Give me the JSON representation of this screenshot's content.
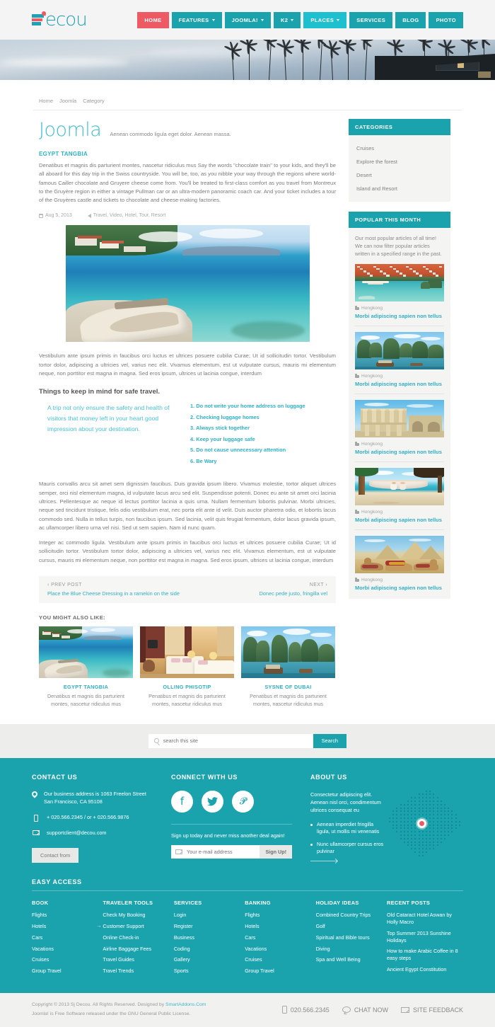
{
  "header": {
    "logo_text": "ecou",
    "nav": [
      {
        "label": "HOME",
        "caret": false,
        "state": "home"
      },
      {
        "label": "FEATURES",
        "caret": true,
        "state": "normal"
      },
      {
        "label": "JOOMLA!",
        "caret": true,
        "state": "normal"
      },
      {
        "label": "K2",
        "caret": true,
        "state": "normal"
      },
      {
        "label": "PLACES",
        "caret": true,
        "state": "active"
      },
      {
        "label": "SERVICES",
        "caret": false,
        "state": "normal"
      },
      {
        "label": "BLOG",
        "caret": false,
        "state": "normal"
      },
      {
        "label": "PHOTO",
        "caret": false,
        "state": "normal"
      }
    ]
  },
  "breadcrumb": [
    "Home",
    "Joomla",
    "Category"
  ],
  "article": {
    "title": "Joomla",
    "subtitle": "Aenean commodo ligula eget dolor. Aenean massa.",
    "post_sub": "EGYPT TANGBIA",
    "intro": "Denatibus et magnis dis parturient montes, nascetur ridiculus mus Say the words \"chocolate train\" to your kids, and they'll be all aboard for this day trip in the Swiss countryside. You will be, too, as you nibble your way through the regions where world-famous Cailler chocolate and Gruyere cheese come from. You'll be treated to first-class comfort as you travel from Montreux to the Gruyère region in either a vintage Pullman car or an ultra-modern panoramic coach car. And your ticket includes a tour of the Gruyères castle and tickets to chocolate and cheese-making factories.",
    "date": "Aug 5, 2013",
    "tags": "Travel, Video, Hotel, Tour, Resort",
    "para2": "Vestibulum ante ipsum primis in faucibus orci luctus et ultrices posuere cubilia Curae; Ut id sollicitudin tortor. Vestibulum tortor dolor, adipiscing a ultricies vel, varius nec elit. Vivamus elementum, est ut vulputate cursus, mauris mi elementum neque, non porttitor est magna in magna. Sed eros ipsum, ultrices ut lacinia congue, interdum",
    "section_heading": "Things to keep in mind for safe travel.",
    "quote": "A trip not only ensure the safety and health of visitors that money left in your heart good impression about your destination.",
    "tips": [
      "Do not write your home address on luggage",
      "Checking luggage homes",
      "Always stick together",
      "Keep your luggage safe",
      "Do not cause unnecessary attention",
      "Be Wary"
    ],
    "para3": "Mauris convallis arcu sit amet sem dignissim faucibus. Duis gravida ipsum libero. Vivamus molestie, tortor aliquet ultrices semper, orci nisl elementum magna, id vulputate lacus arcu sed elit. Suspendisse potenti. Donec eu ante sit amet orci lacinia ultrices. Pellentesque ac neque id lectus porttitor lacinia a quis urna. Nullam fermentum lobortis pulvinar. Morbi ultricies, neque sed tincidunt tristique, felis odio vestibulum erat, nec porta elit ante id velit. Duis auctor pharetra odio, et lobortis lacus commodo sed. Nulla in tellus turpis, non faucibus ipsum. Sed lacinia, velit quis feugiat fermentum, dolor lacus gravida ipsum, ac ullamcorper libero urna vel nisi. Sed ut sem sapien. Nam id nunc quam.",
    "para4": "Integer ac commodo ligula. Vestibulum ante ipsum primis in faucibus orci luctus et ultrices posuere cubilia Curae; Ut id sollicitudin tortor. Vestibulum tortor dolor, adipiscing a ultricies vel, varius nec elit. Vivamus elementum, est ut vulputate cursus, mauris mi elementum neque, non porttitor est magna in magna. Sed eros ipsum, ultrices ut lacinia congue, interdum"
  },
  "postnav": {
    "prev_label": "‹ PREV POST",
    "prev_link": "Place the Blue Cheese Dressing in a ramekin on the side",
    "next_label": "NEXT ›",
    "next_link": "Donec pede justo, fringilla vel"
  },
  "also_like": {
    "heading": "YOU MIGHT ALSO LIKE:",
    "cards": [
      {
        "title": "EGYPT TANGBIA",
        "desc": "Denatibus et magnis dis parturient montes, nascetur ridiculus mus",
        "image": "beach-stone-boat"
      },
      {
        "title": "OLLING PHISOTIP",
        "desc": "Penatibus et magnis dis parturient montes, nascetur ridiculus mus",
        "image": "hotel-room"
      },
      {
        "title": "SYSNE OF DUBAI",
        "desc": "Penatibus et magnis dis parturient montes, nascetur ridiculus mus",
        "image": "halong-bay"
      }
    ]
  },
  "sidebar": {
    "categories_title": "CATEGORIES",
    "categories": [
      "Cruises",
      "Explore the forest",
      "Desert",
      "Island and Resort"
    ],
    "popular_title": "POPULAR THIS MONTH",
    "popular_intro": "Our most popular articles of all time! We can now filter popular articles written in a specified range in the past.",
    "popular_items": [
      {
        "category": "Hongkong",
        "title": "Morbi adipiscing sapien non tellus",
        "image": "dubrovnik-coast"
      },
      {
        "category": "Hongkong",
        "title": "Morbi adipiscing sapien non tellus",
        "image": "halong-bay"
      },
      {
        "category": "Hongkong",
        "title": "Morbi adipiscing sapien non tellus",
        "image": "ephesus-ruins"
      },
      {
        "category": "Hongkong",
        "title": "Morbi adipiscing sapien non tellus",
        "image": "beach-hammock"
      },
      {
        "category": "Hongkong",
        "title": "Morbi adipiscing sapien non tellus",
        "image": "camels-pyramids"
      }
    ]
  },
  "search": {
    "placeholder": "search this site",
    "button": "Search"
  },
  "footer": {
    "contact": {
      "title": "CONTACT US",
      "address": "Our business address is 1063 Freelon Street San Francisco, CA 95108",
      "phone": "+ 020.566.2345 /  or  + 020.566.9876",
      "email": "supportclient@decou.com",
      "button": "Contact from"
    },
    "connect": {
      "title": "CONNECT WITH US",
      "socials": [
        "facebook-icon",
        "twitter-icon",
        "pinterest-icon"
      ],
      "signup_text": "Sign up today and never miss another deal again!",
      "email_placeholder": "Your e-mail address",
      "signup_button": "Sign Up!"
    },
    "about": {
      "title": "ABOUT US",
      "text": "Consectetur adipiscing elit. Aenean nisl orci, condimentum ultrices consequat eu",
      "bullets": [
        "Aenean imperdiet fringilla ligula, ut mollis mi venenatis",
        "Nunc ullamcorper cursus eros pulvinar"
      ]
    },
    "easy_access": {
      "title": "EASY ACCESS",
      "columns": [
        {
          "title": "BOOK",
          "items": [
            "Flights",
            "Hotels",
            "Cars",
            "Vacations",
            "Cruises",
            "Group Travel"
          ]
        },
        {
          "title": "TRAVELER TOOLS",
          "items": [
            "Check My Booking",
            "Customer Support",
            "Online Check-in",
            "Airline Baggage Fees",
            "Travel Guides",
            "Travel Trends"
          ],
          "marked_index": 1
        },
        {
          "title": "SERVICES",
          "items": [
            "Login",
            "Register",
            "Business",
            "Coding",
            "Gallery",
            "Sports"
          ]
        },
        {
          "title": "BANKING",
          "items": [
            "Flights",
            "Hotels",
            "Cars",
            "Vacations",
            "Cruises",
            "Group Travel"
          ]
        },
        {
          "title": "HOLIDAY IDEAS",
          "items": [
            "Combined Country Trips",
            "Golf",
            "Spiritual and Bible tours",
            "Diving",
            "Spa and Well Being"
          ]
        },
        {
          "title": "RECENT POSTS",
          "items": [
            "Old Cataract Hotel Aswan by Holly Macro",
            "Top Summer 2013 Sunshine Holidays",
            "How to make Arabic Coffee in 8 easy steps",
            "Ancient Egypt Constitution"
          ]
        }
      ]
    },
    "bottom": {
      "copyright_prefix": "Copyright © 2013 Sj Decou. All Rights Reserved. Designed by ",
      "designer": "SmartAddons.Com",
      "license": "Joomla! is Free Software released under the GNU General Public License.",
      "phone": "020.566.2345",
      "chat": "CHAT NOW",
      "feedback": "SITE FEEDBACK"
    }
  },
  "colors": {
    "teal": "#1ba3ad",
    "teal_light": "#1ec0cf",
    "coral": "#ee5a63",
    "link": "#2fb0c6"
  }
}
